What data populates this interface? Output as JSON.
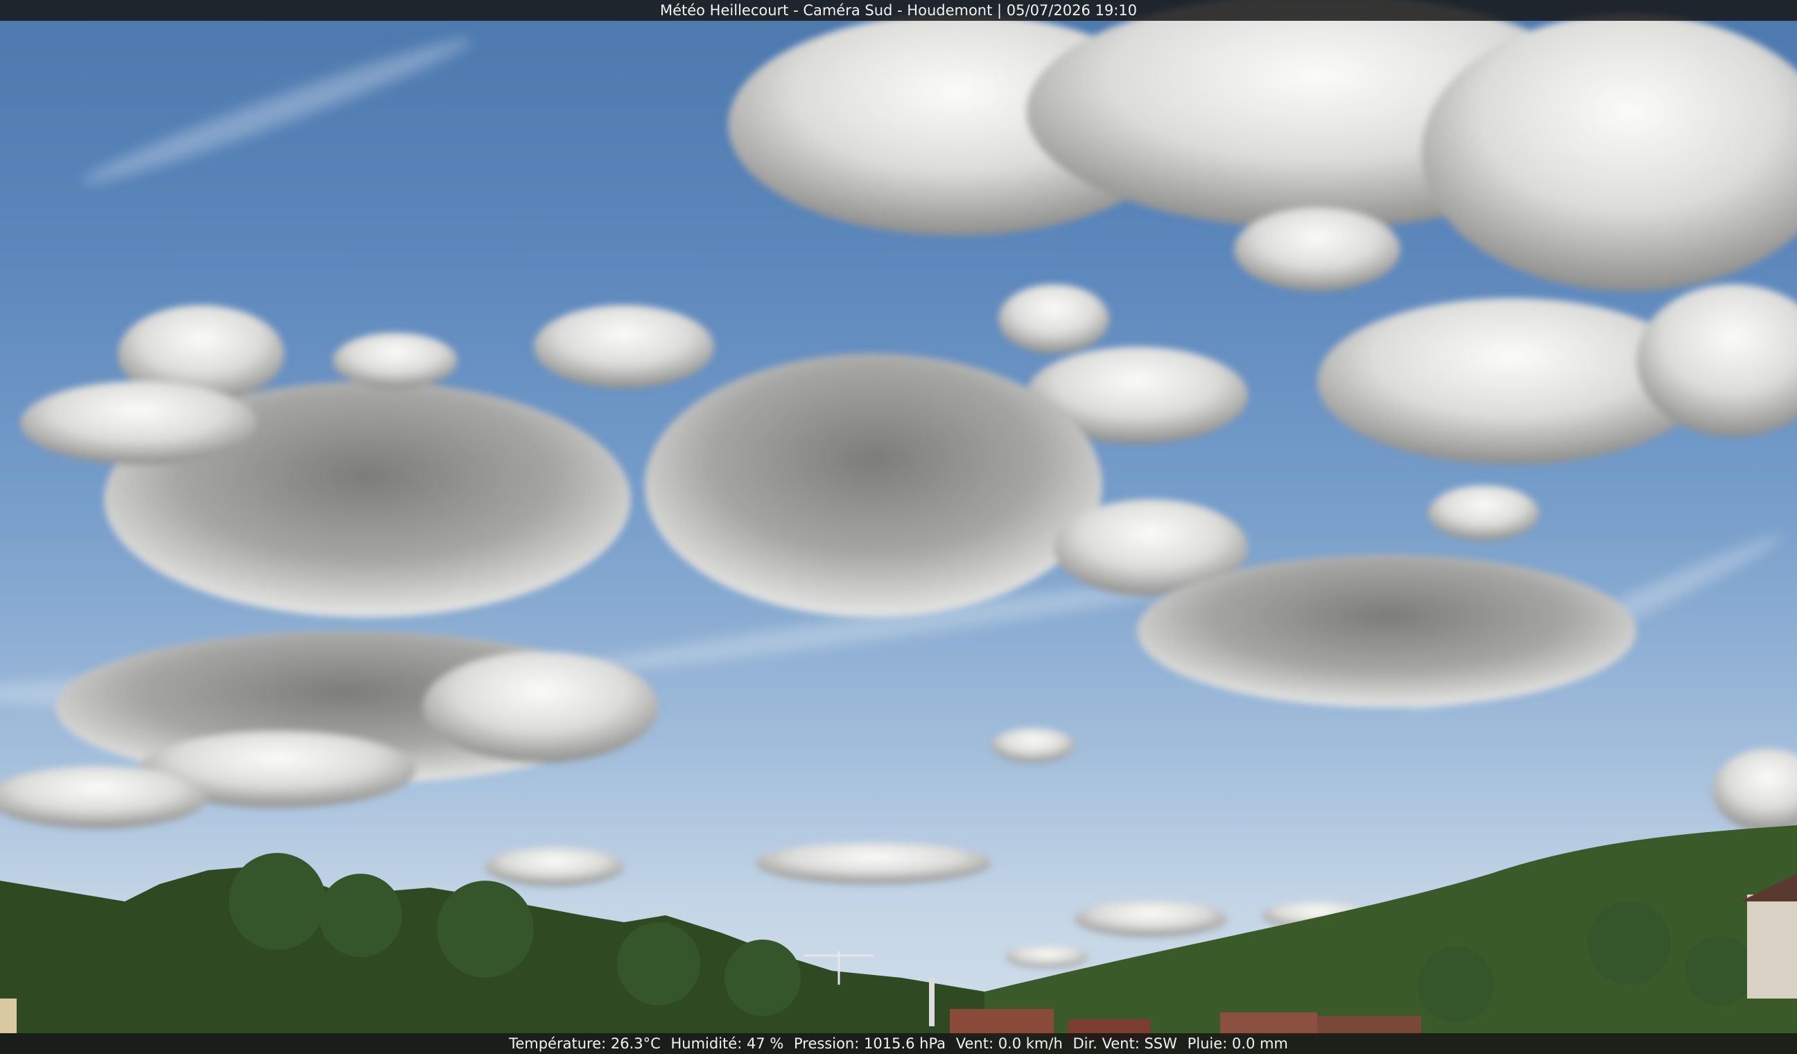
{
  "overlay": {
    "title": "Météo Heillecourt - Caméra Sud - Houdemont | 05/07/2026 19:10"
  },
  "weather": {
    "temperature": "Température: 26.3°C",
    "humidity": "Humidité: 47 %",
    "pressure": "Pression: 1015.6 hPa",
    "wind_speed": "Vent: 0.0 km/h",
    "wind_dir": "Dir. Vent: SSW",
    "rain": "Pluie: 0.0 mm"
  },
  "colors": {
    "sky_top": "#4c78ad",
    "sky_horizon": "#d4e0ea",
    "cloud_light": "#f2f2f0",
    "cloud_shadow": "#8a8a88",
    "trees": "#2f4a22",
    "hill": "#3a5a2a"
  }
}
